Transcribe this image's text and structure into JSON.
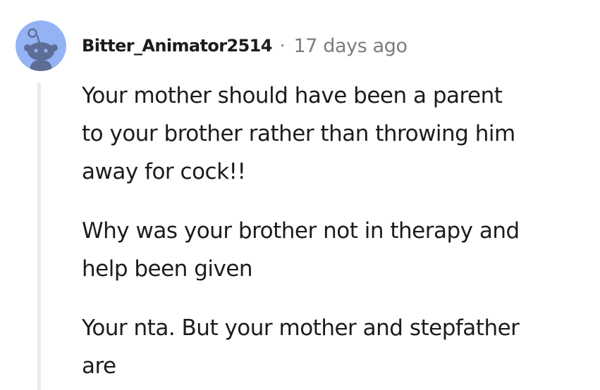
{
  "comment": {
    "username": "Bitter_Animator2514",
    "separator": "·",
    "timestamp": "17 days ago",
    "avatar_icon": "reddit-snoo-avatar-icon",
    "avatar_color": "#94b3f5",
    "avatar_figure_color": "#5e6d96",
    "body": {
      "paragraphs": [
        {
          "lines": [
            "Your mother should have been a parent",
            "to your brother rather than throwing him",
            "away for cock!!"
          ]
        },
        {
          "lines": [
            "Why was your brother not in therapy and",
            "help been given"
          ]
        },
        {
          "lines": [
            "Your nta. But your mother and stepfather",
            "are"
          ]
        }
      ]
    }
  },
  "colors": {
    "text": "#1c1c1c",
    "meta_text": "#7c7c7c",
    "thread_line": "#e8eaeb"
  }
}
